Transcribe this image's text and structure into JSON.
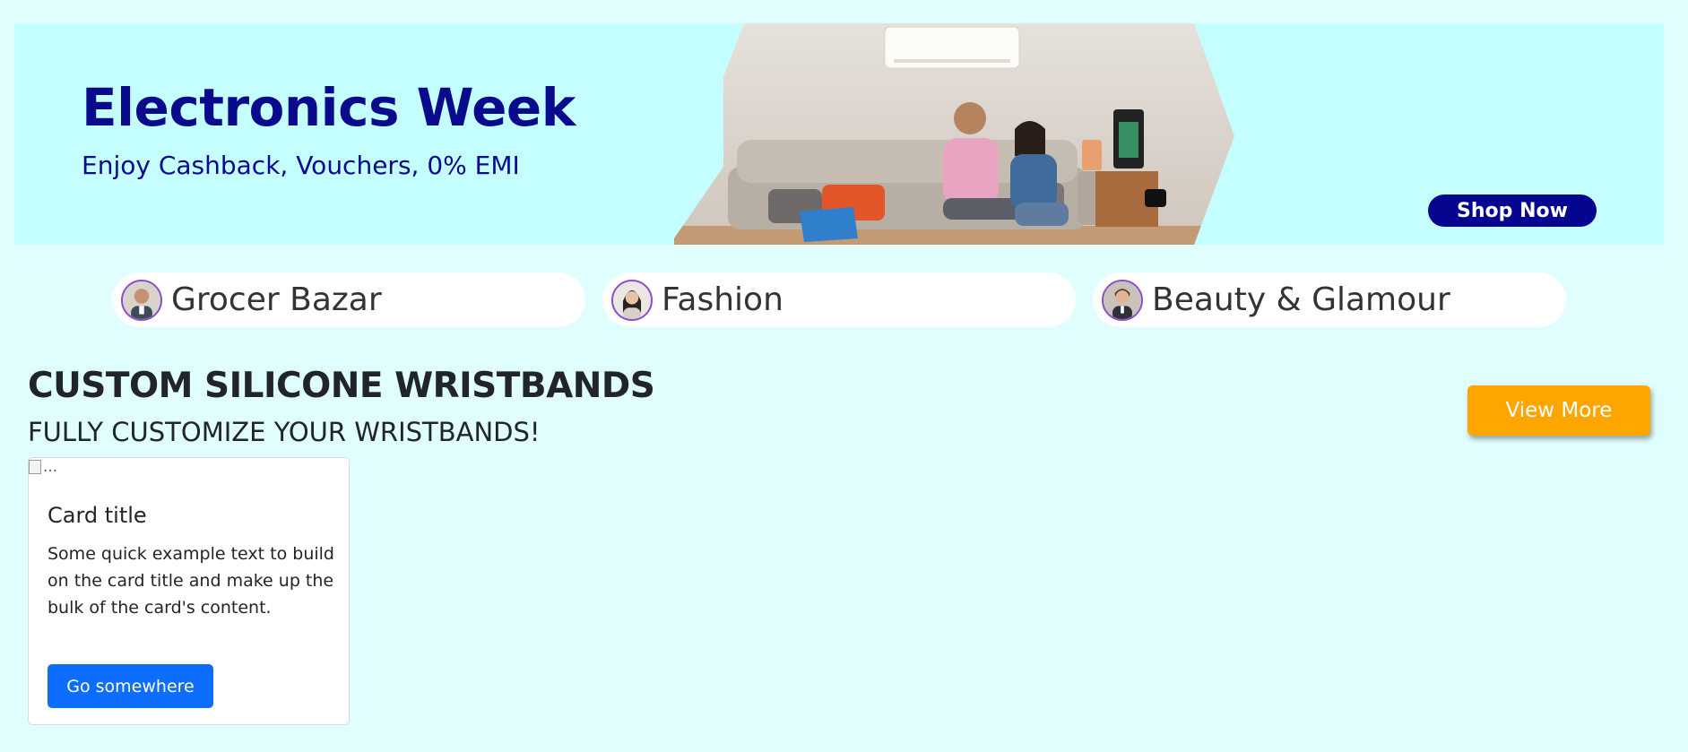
{
  "banner": {
    "title": "Electronics Week",
    "subtitle": "Enjoy Cashback, Vouchers, 0% EMI",
    "cta_label": "Shop Now",
    "title_color": "#0a0a8c",
    "background_color": "#c4fefe"
  },
  "categories": [
    {
      "label": "Grocer Bazar",
      "icon": "avatar-man-icon"
    },
    {
      "label": "Fashion",
      "icon": "avatar-woman-icon"
    },
    {
      "label": "Beauty & Glamour",
      "icon": "avatar-man-icon"
    }
  ],
  "section": {
    "title": "CUSTOM SILICONE WRISTBANDS",
    "subtitle": "FULLY CUSTOMIZE YOUR WRISTBANDS!",
    "view_more_label": "View More",
    "accent_color": "#ffa500"
  },
  "card": {
    "image_alt": "...",
    "title": "Card title",
    "text": "Some quick example text to build on the card title and make up the bulk of the card's content.",
    "button_label": "Go somewhere",
    "button_color": "#0d6efd"
  }
}
